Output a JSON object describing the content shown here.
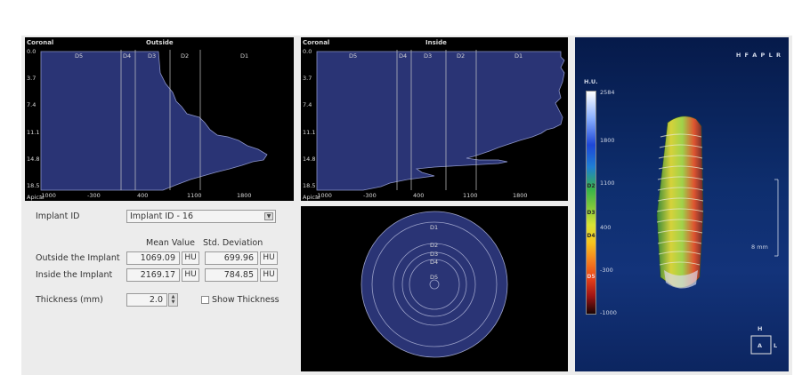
{
  "outside_chart": {
    "corner_label": "Coronal",
    "title": "Outside",
    "bottom_label": "Apical",
    "y_ticks": [
      "0.0",
      "3.7",
      "7.4",
      "11.1",
      "14.8",
      "18.5"
    ],
    "x_ticks": [
      "-1000",
      "-300",
      "400",
      "1100",
      "1800"
    ],
    "zones": [
      "D5",
      "D4",
      "D3",
      "D2",
      "D1"
    ]
  },
  "inside_chart": {
    "corner_label": "Coronal",
    "title": "Inside",
    "bottom_label": "Apical",
    "y_ticks": [
      "0.0",
      "3.7",
      "7.4",
      "11.1",
      "14.8",
      "18.5"
    ],
    "x_ticks": [
      "-1000",
      "-300",
      "400",
      "1100",
      "1800"
    ],
    "zones": [
      "D5",
      "D4",
      "D3",
      "D2",
      "D1"
    ]
  },
  "controls": {
    "implant_id_label": "Implant ID",
    "implant_id_value": "Implant ID -  16",
    "mean_header": "Mean Value",
    "std_header": "Std. Deviation",
    "outside_label": "Outside the Implant",
    "outside_mean": "1069.09",
    "outside_std": "699.96",
    "inside_label": "Inside the Implant",
    "inside_mean": "2169.17",
    "inside_std": "784.85",
    "unit": "HU",
    "thickness_label": "Thickness (mm)",
    "thickness_value": "2.0",
    "show_thickness_label": "Show Thickness",
    "show_thickness_checked": false
  },
  "ring_diagram": {
    "rings": [
      "D1",
      "D2",
      "D3",
      "D4",
      "D5"
    ]
  },
  "viewer": {
    "orientation": "H F A P L R",
    "colorbar_title": "H.U.",
    "colorbar_ticks": [
      "2584",
      "1800",
      "1100",
      "400",
      "-300",
      "-1000"
    ],
    "colorbar_segments": [
      "D2",
      "D3",
      "D4",
      "D5"
    ],
    "scale_label": "8 mm",
    "cube_top": "H",
    "cube_front": "A",
    "cube_side": "L"
  }
}
